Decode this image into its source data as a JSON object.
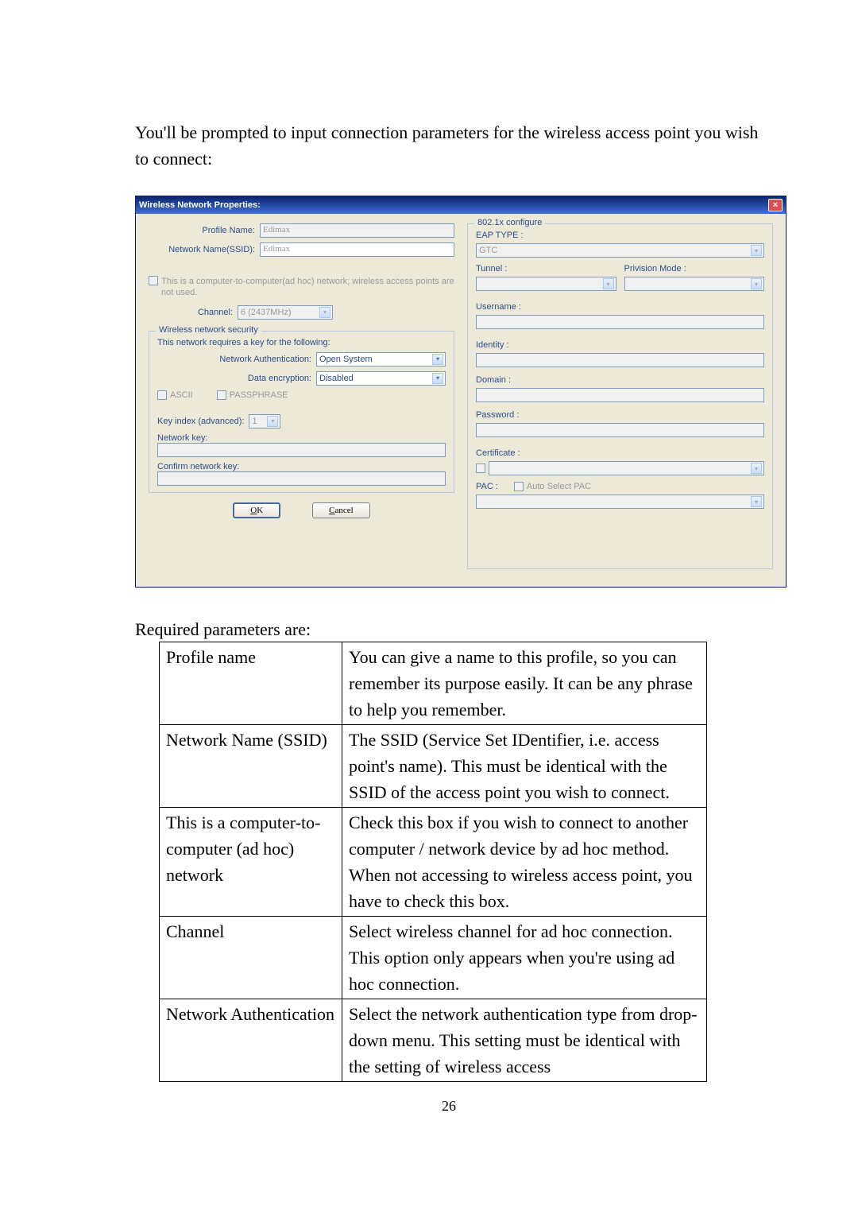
{
  "intro": "You'll be prompted to input connection parameters for the wireless access point you wish to connect:",
  "dialog": {
    "title": "Wireless Network Properties:",
    "close": "×",
    "left": {
      "profileNameLabel": "Profile Name:",
      "profileNameValue": "Edimax",
      "ssidLabel": "Network Name(SSID):",
      "ssidValue": "Edimax",
      "adhocCheckLabel": "This is a computer-to-computer(ad hoc) network; wireless access points are not used.",
      "channelLabel": "Channel:",
      "channelValue": "6  (2437MHz)",
      "securityGroup": "Wireless network security",
      "securityDesc": "This network requires a key for the following:",
      "netAuthLabel": "Network Authentication:",
      "netAuthValue": "Open System",
      "dataEncLabel": "Data encryption:",
      "dataEncValue": "Disabled",
      "asciiLabel": "ASCII",
      "passphraseLabel": "PASSPHRASE",
      "keyIndexLabel": "Key index (advanced):",
      "keyIndexValue": "1",
      "netKeyLabel": "Network key:",
      "confirmKeyLabel": "Confirm network key:",
      "okBtn": "OK",
      "cancelBtn": "Cancel"
    },
    "right": {
      "group": "802.1x configure",
      "eapTypeLabel": "EAP TYPE :",
      "eapTypeValue": "GTC",
      "tunnelLabel": "Tunnel :",
      "privisionLabel": "Privision Mode :",
      "usernameLabel": "Username :",
      "identityLabel": "Identity :",
      "domainLabel": "Domain :",
      "passwordLabel": "Password :",
      "certLabel": "Certificate :",
      "pacLabel": "PAC :",
      "autoSelectPac": "Auto Select PAC"
    }
  },
  "required": "Required parameters are:",
  "table": {
    "r1c1": "Profile name",
    "r1c2": "You can give a name to this profile, so you can remember its purpose easily. It can be any phrase to help you remember.",
    "r2c1": "Network Name (SSID)",
    "r2c2": "The SSID (Service Set IDentifier, i.e. access point's name). This must be identical with the SSID of the access point you wish to connect.",
    "r3c1": "This is a computer-to-computer (ad hoc) network",
    "r3c2": "Check this box if you wish to connect to another computer / network device by ad hoc method. When not accessing to wireless access point, you have to check this box.",
    "r4c1": "Channel",
    "r4c2": "Select wireless channel for ad hoc connection. This option only appears when you're using ad hoc connection.",
    "r5c1": "Network Authentication",
    "r5c2": "Select the network authentication type from drop-down menu. This setting must be identical with the setting of wireless access"
  },
  "pagenum": "26"
}
